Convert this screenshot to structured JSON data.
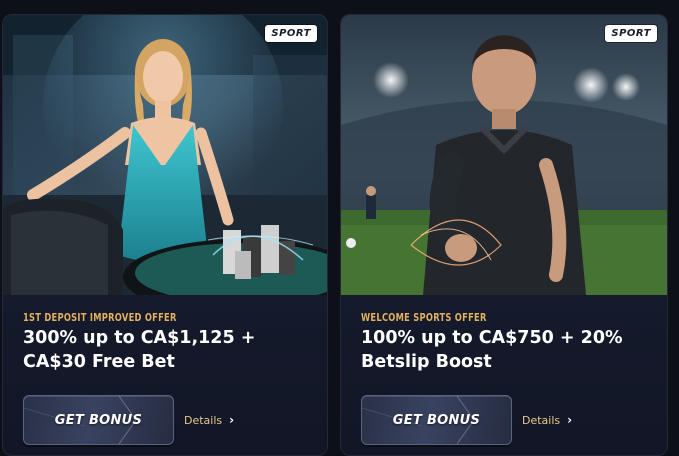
{
  "cards": [
    {
      "badge": "SPORT",
      "eyebrow": "1ST DEPOSIT IMPROVED OFFER",
      "headline": "300% up to CA$1,125 + CA$30 Free Bet",
      "cta_label": "GET BONUS",
      "details_label": "Details",
      "image": "casino-dealer-woman-with-chips"
    },
    {
      "badge": "SPORT",
      "eyebrow": "WELCOME SPORTS OFFER",
      "headline": "100% up to CA$750 + 20% Betslip Boost",
      "cta_label": "GET BONUS",
      "details_label": "Details",
      "image": "referee-in-stadium-reaching-hand"
    }
  ],
  "colors": {
    "page_bg": "#0e1017",
    "card_bg": "#161a2b",
    "eyebrow": "#e3b15e",
    "details": "#e8c88b",
    "headline": "#ffffff"
  },
  "icons": [
    "chevron-right-icon"
  ]
}
